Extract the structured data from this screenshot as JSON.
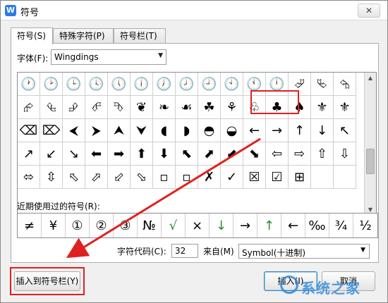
{
  "window": {
    "title": "符号"
  },
  "tabs": [
    {
      "label": "符号(S)"
    },
    {
      "label": "特殊字符(P)"
    },
    {
      "label": "符号栏(T)"
    }
  ],
  "font": {
    "label": "字体(F):",
    "value": "Wingdings"
  },
  "symbol_grid": [
    [
      "🕐",
      "🕑",
      "🕒",
      "🕓",
      "🕔",
      "🕕",
      "🕖",
      "🕗",
      "🕘",
      "🕙",
      "🕚",
      "🕛",
      "⮰",
      "⮱",
      "⮲"
    ],
    [
      "⮳",
      "⮴",
      "⮵",
      "⮶",
      "⮷",
      "❦",
      "❧",
      "☙",
      "☘",
      "⚘",
      "♧",
      "♣",
      "♠",
      "⚜",
      "⚜"
    ],
    [
      "⌫",
      "⌦",
      "⮜",
      "⮞",
      "⮝",
      "⮟",
      "◖",
      "◗",
      "◓",
      "◒",
      "←",
      "→",
      "↑",
      "↓",
      "↖"
    ],
    [
      "↗",
      "↙",
      "↘",
      "⬅",
      "➡",
      "⬆",
      "⬇",
      "⬉",
      "⬈",
      "⬋",
      "⬊",
      "⇦",
      "⇨",
      "⇧",
      "⇩"
    ],
    [
      "⬄",
      "⇳",
      "⬁",
      "⬀",
      "⬃",
      "⬂",
      "▫",
      "▫",
      "✗",
      "✓",
      "☒",
      "☑",
      "⊞",
      "",
      ""
    ]
  ],
  "recent": {
    "label": "近期使用过的符号(R):",
    "items": [
      "≠",
      "¥",
      "①",
      "②",
      "③",
      "№",
      "√",
      "×",
      "↓",
      "→",
      "↑",
      "←",
      "‰",
      "¾",
      "½"
    ]
  },
  "char_code": {
    "label": "字符代码(C):",
    "value": "32"
  },
  "from": {
    "label": "来自(M)",
    "value": "Symbol(十进制)"
  },
  "buttons": {
    "insert_to_bar": "插入到符号栏(Y)",
    "insert": "插入(I)",
    "cancel": "取消"
  },
  "watermark": {
    "text": "系统之家"
  },
  "colors": {
    "highlight": "#e02020",
    "accent": "#2b86d8",
    "recent_green": "#2a8a2a"
  }
}
